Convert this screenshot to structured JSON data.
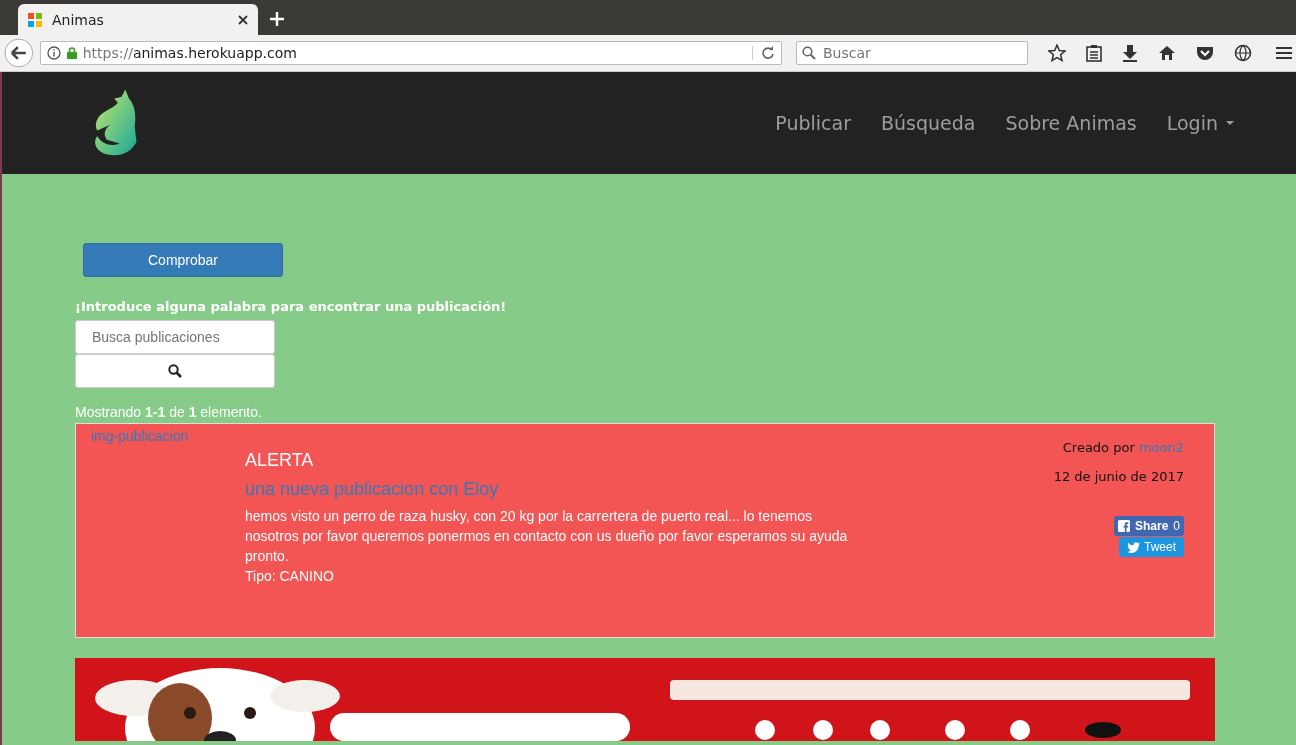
{
  "browser": {
    "tab_title": "Animas",
    "url_scheme": "https://",
    "url_host": "animas.herokuapp.com",
    "search_placeholder": "Buscar"
  },
  "nav": {
    "items": [
      {
        "label": "Publicar",
        "dropdown": false
      },
      {
        "label": "Búsqueda",
        "dropdown": false
      },
      {
        "label": "Sobre Animas",
        "dropdown": false
      },
      {
        "label": "Login",
        "dropdown": true
      }
    ]
  },
  "check_button": "Comprobar",
  "search": {
    "prompt": "¡Introduce alguna palabra para encontrar una publicación!",
    "placeholder": "Busca publicaciones"
  },
  "summary": "Mostrando **1-1** de **1** elemento.",
  "posts": [
    {
      "image_alt": "img-publicacion",
      "category": "ALERTA",
      "title": "una nueva publicacion con Eloy",
      "body": "hemos visto un perro de raza husky, con 20 kg por la carrertera de puerto real... lo tenemos nosotros por favor queremos ponermos en contacto con us dueño por favor esperamos su ayuda pronto.",
      "type": "Tipo: CANINO",
      "created_by": "Creado por",
      "author": "moon2",
      "date": "12 de junio de 2017",
      "share_label": "Share",
      "share_count": "0",
      "tweet_label": "Tweet"
    }
  ]
}
